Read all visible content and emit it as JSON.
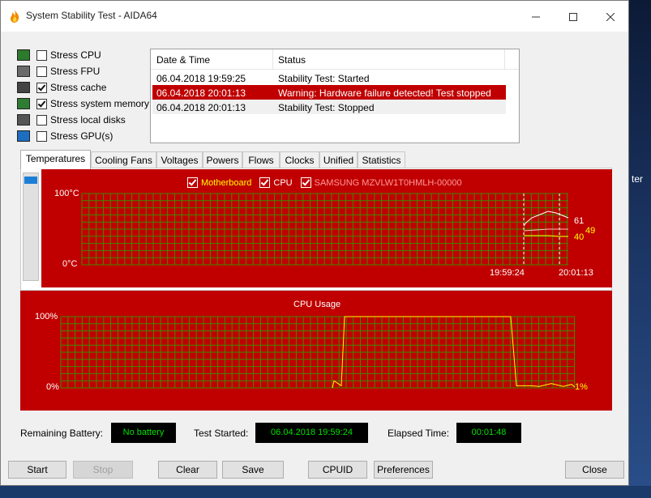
{
  "window": {
    "title": "System Stability Test - AIDA64"
  },
  "desktop": {
    "fragment": "ter"
  },
  "stress": [
    {
      "label": "Stress CPU",
      "checked": false,
      "icon": "cpu-chip-icon"
    },
    {
      "label": "Stress FPU",
      "checked": false,
      "icon": "fpu-icon"
    },
    {
      "label": "Stress cache",
      "checked": true,
      "icon": "cache-icon"
    },
    {
      "label": "Stress system memory",
      "checked": true,
      "icon": "memory-module-icon"
    },
    {
      "label": "Stress local disks",
      "checked": false,
      "icon": "disk-icon"
    },
    {
      "label": "Stress GPU(s)",
      "checked": false,
      "icon": "monitor-icon"
    }
  ],
  "log": {
    "headers": [
      "Date & Time",
      "Status"
    ],
    "rows": [
      {
        "time": "06.04.2018 19:59:25",
        "status": "Stability Test: Started",
        "state": "normal"
      },
      {
        "time": "06.04.2018 20:01:13",
        "status": "Warning: Hardware failure detected! Test stopped",
        "state": "selected"
      },
      {
        "time": "06.04.2018 20:01:13",
        "status": "Stability Test: Stopped",
        "state": "alt"
      }
    ]
  },
  "tabs": [
    "Temperatures",
    "Cooling Fans",
    "Voltages",
    "Powers",
    "Flows",
    "Clocks",
    "Unified",
    "Statistics"
  ],
  "temp_chart": {
    "legend": [
      {
        "label": "Motherboard",
        "checked": true,
        "color": "#ffff00"
      },
      {
        "label": "CPU",
        "checked": true,
        "color": "#ffffff"
      },
      {
        "label": "SAMSUNG MZVLW1T0HMLH-00000",
        "checked": true,
        "color": "#ff9999"
      }
    ],
    "y_top": "100°C",
    "y_bottom": "0°C",
    "x_labels": [
      "19:59:24",
      "20:01:13"
    ],
    "readouts": [
      "61",
      "49",
      "40"
    ]
  },
  "cpu_chart": {
    "title": "CPU Usage",
    "y_top": "100%",
    "y_bottom": "0%",
    "readout": "1%"
  },
  "chart_data": [
    {
      "type": "line",
      "title": "",
      "xlabel": "",
      "ylabel": "",
      "ylim": [
        0,
        100
      ],
      "x": [
        "19:59:24",
        "20:01:13"
      ],
      "series": [
        {
          "name": "CPU",
          "latest": 61
        },
        {
          "name": "SAMSUNG MZVLW1T0HMLH-00000",
          "latest": 49
        },
        {
          "name": "Motherboard",
          "latest": 40
        }
      ]
    },
    {
      "type": "line",
      "title": "CPU Usage",
      "ylim": [
        0,
        100
      ],
      "values": [
        0,
        10,
        3,
        100,
        100,
        100,
        100,
        100,
        100,
        100,
        100,
        100,
        3,
        3,
        2,
        6,
        2,
        5,
        1
      ],
      "latest": 1
    }
  ],
  "status": {
    "battery_label": "Remaining Battery:",
    "battery_value": "No battery",
    "started_label": "Test Started:",
    "started_value": "06.04.2018 19:59:24",
    "elapsed_label": "Elapsed Time:",
    "elapsed_value": "00:01:48"
  },
  "buttons": {
    "start": "Start",
    "stop": "Stop",
    "clear": "Clear",
    "save": "Save",
    "cpuid": "CPUID",
    "preferences": "Preferences",
    "close": "Close"
  }
}
